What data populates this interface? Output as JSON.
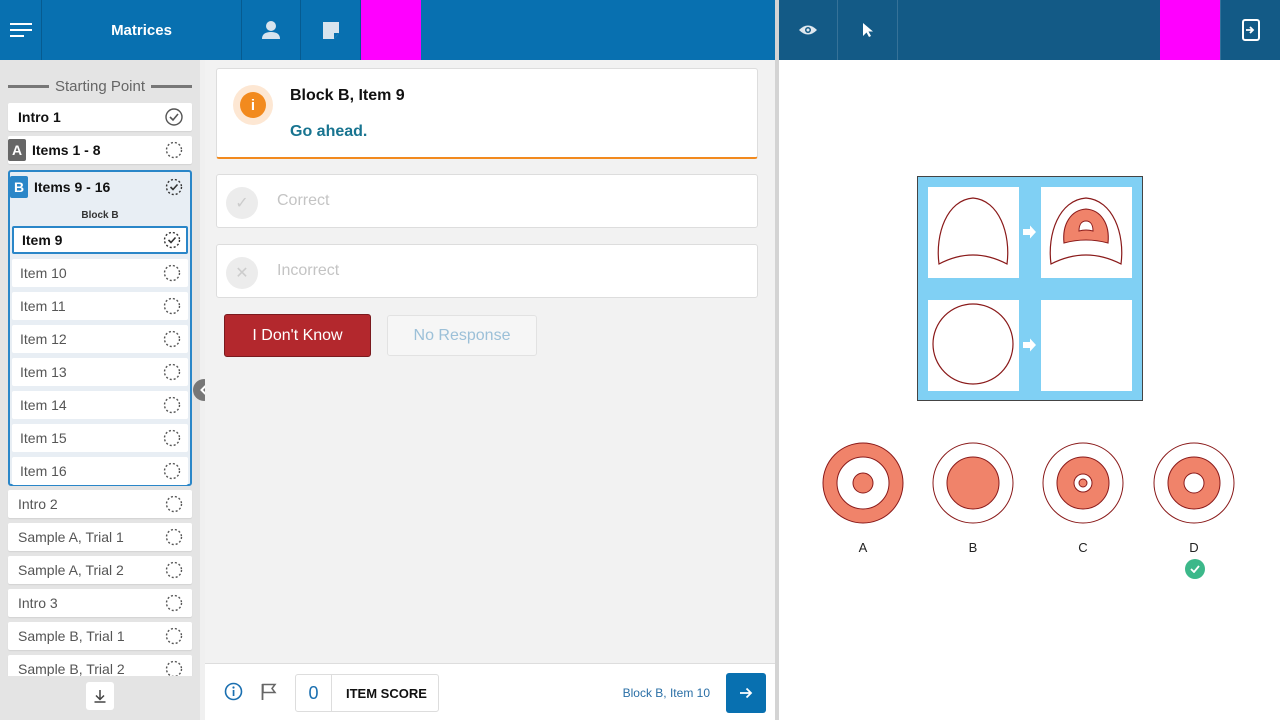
{
  "header": {
    "title": "Matrices",
    "icons": [
      "menu-icon",
      "person-icon",
      "note-icon",
      "eye-icon",
      "pointer-icon",
      "device-icon"
    ],
    "accent_color": "#0870b0"
  },
  "sidebar": {
    "heading": "Starting Point",
    "intro1": "Intro 1",
    "blockA_letter": "A",
    "blockA_label": "Items 1 - 8",
    "blockB": {
      "letter": "B",
      "label": "Items 9 - 16",
      "sub": "Block B",
      "items": [
        "Item 9",
        "Item 10",
        "Item 11",
        "Item 12",
        "Item 13",
        "Item 14",
        "Item 15",
        "Item 16"
      ]
    },
    "rest": [
      "Intro 2",
      "Sample A, Trial 1",
      "Sample A, Trial 2",
      "Intro 3",
      "Sample B, Trial 1",
      "Sample B, Trial 2"
    ]
  },
  "info": {
    "title": "Block B, Item 9",
    "message": "Go ahead."
  },
  "options": {
    "correct": "Correct",
    "incorrect": "Incorrect"
  },
  "buttons": {
    "dont_know": "I Don't Know",
    "no_response": "No Response"
  },
  "footer": {
    "score_value": "0",
    "score_label": "ITEM SCORE",
    "next_label": "Block B, Item 10"
  },
  "choices": {
    "labels": [
      "A",
      "B",
      "C",
      "D"
    ],
    "selected": "D"
  }
}
